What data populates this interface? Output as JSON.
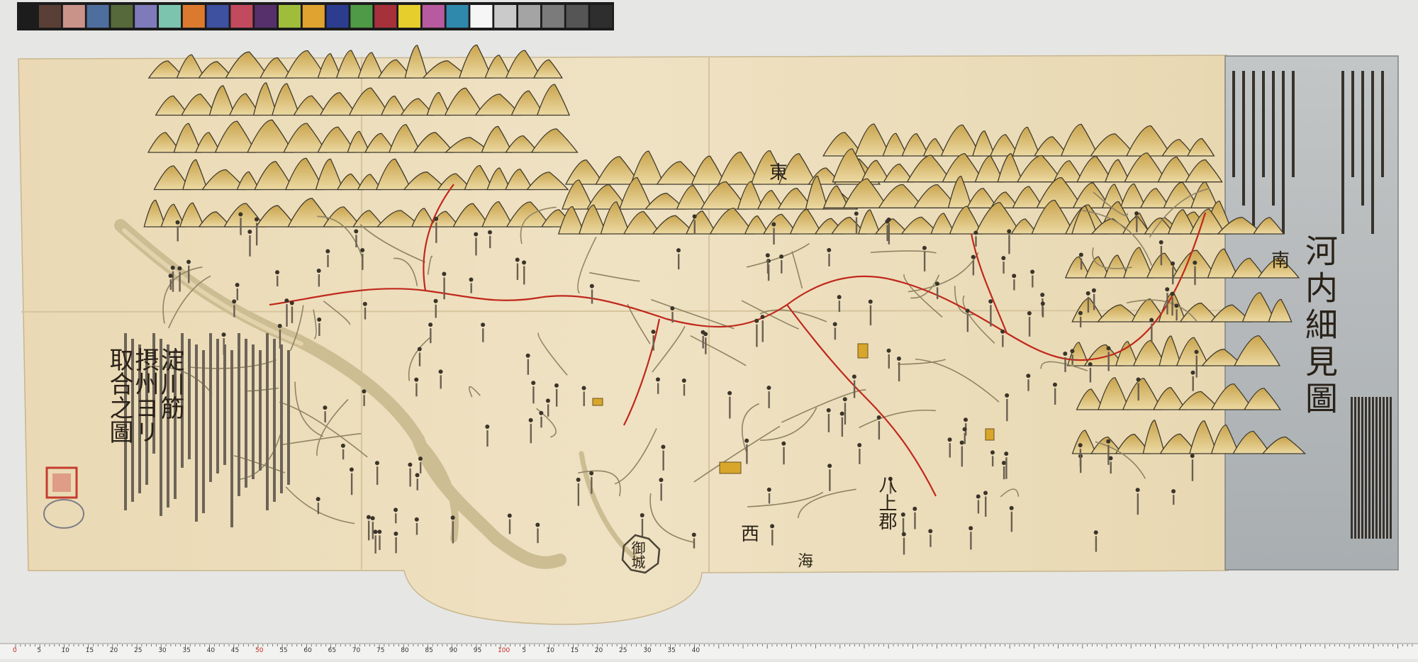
{
  "map": {
    "title": "河内細見圖",
    "corner_label_lines": [
      "淀川筋",
      "摂州ヨリ",
      "取合之圖"
    ],
    "direction_east": "東",
    "direction_west": "西",
    "direction_south": "南",
    "castle_label": "御城",
    "district_label": "八上郡",
    "sea_label": "海"
  },
  "colors": {
    "paper": "#ecdfbf",
    "mountain_fill": "#d5b35f",
    "mountain_ink": "#3f3a2e",
    "road_red": "#c0281c",
    "river": "#cfc09a",
    "cover_panel": "#b8bcbe",
    "seal_red": "#c53c2f"
  },
  "color_chart": [
    "#5a3f36",
    "#c9938a",
    "#4e6f9e",
    "#56693a",
    "#7f7bba",
    "#7cc4ae",
    "#db7a2e",
    "#3e50a0",
    "#c24a5e",
    "#56306b",
    "#9fbd3b",
    "#e0a330",
    "#2c3c8f",
    "#4f9a46",
    "#a6313a",
    "#e6ce2d",
    "#b85aa0",
    "#2f89ad",
    "#f6f6f6",
    "#cacaca",
    "#a4a4a4",
    "#7b7b7b",
    "#555555",
    "#2e2e2e"
  ],
  "ruler": {
    "labels": [
      "0",
      "5",
      "10",
      "15",
      "20",
      "25",
      "30",
      "35",
      "40",
      "45",
      "50",
      "55",
      "60",
      "65",
      "70",
      "75",
      "80",
      "85",
      "90",
      "95",
      "100",
      "5",
      "10",
      "15",
      "20",
      "25",
      "30",
      "35",
      "40"
    ]
  }
}
